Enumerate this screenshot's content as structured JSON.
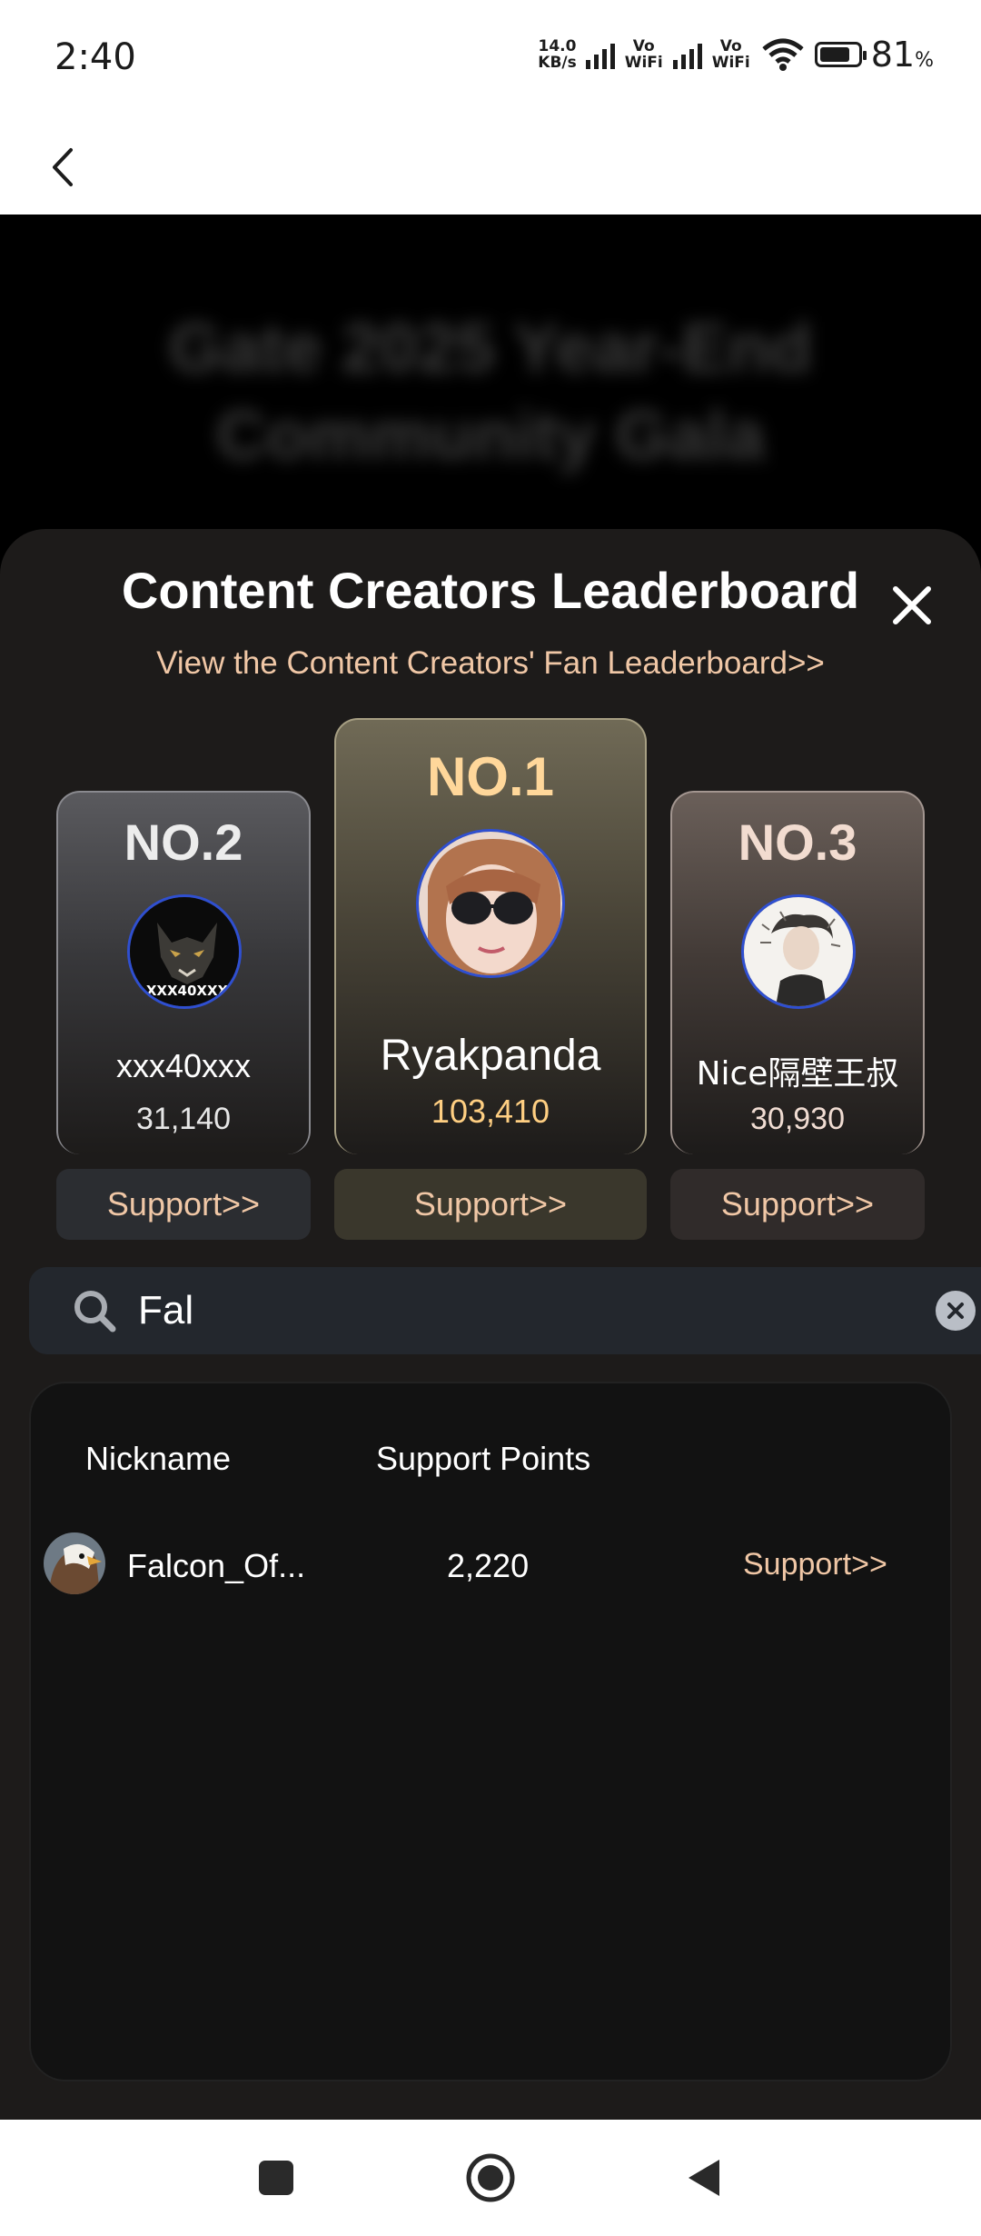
{
  "status_bar": {
    "time": "2:40",
    "net_speed_value": "14.0",
    "net_speed_unit": "KB/s",
    "vowifi_1": "Vo WiFi",
    "vowifi_2": "Vo WiFi",
    "battery_percent": "81",
    "battery_symbol": "%",
    "battery_level": 0.81
  },
  "header": {
    "back_icon": "chevron-left-icon"
  },
  "hero": {
    "title": "Gate 2025 Year-End Community Gala"
  },
  "leaderboard": {
    "title": "Content Creators Leaderboard",
    "fan_link": "View the Content Creators' Fan Leaderboard>>",
    "close_icon": "close-icon",
    "podium": [
      {
        "rank": "NO.2",
        "name": "xxx40xxx",
        "score": "31,140",
        "support": "Support>>",
        "avatar_text": "XXX40XXX"
      },
      {
        "rank": "NO.1",
        "name": "Ryakpanda",
        "score": "103,410",
        "support": "Support>>"
      },
      {
        "rank": "NO.3",
        "name": "Nice隔壁王叔",
        "score": "30,930",
        "support": "Support>>"
      }
    ],
    "colors": {
      "accent": "#f0c7a6",
      "gold": "#ffd79a",
      "sheet_bg": "#1d1b1a"
    }
  },
  "search": {
    "value": "Fal",
    "icon": "search-icon",
    "clear_icon": "clear-icon"
  },
  "results": {
    "columns": [
      "Nickname",
      "Support Points"
    ],
    "rows": [
      {
        "name": "Falcon_Of...",
        "points": "2,220",
        "action": "Support>>"
      }
    ]
  },
  "nav": {
    "recent_icon": "square-icon",
    "home_icon": "circle-home-icon",
    "back_icon": "triangle-back-icon"
  }
}
